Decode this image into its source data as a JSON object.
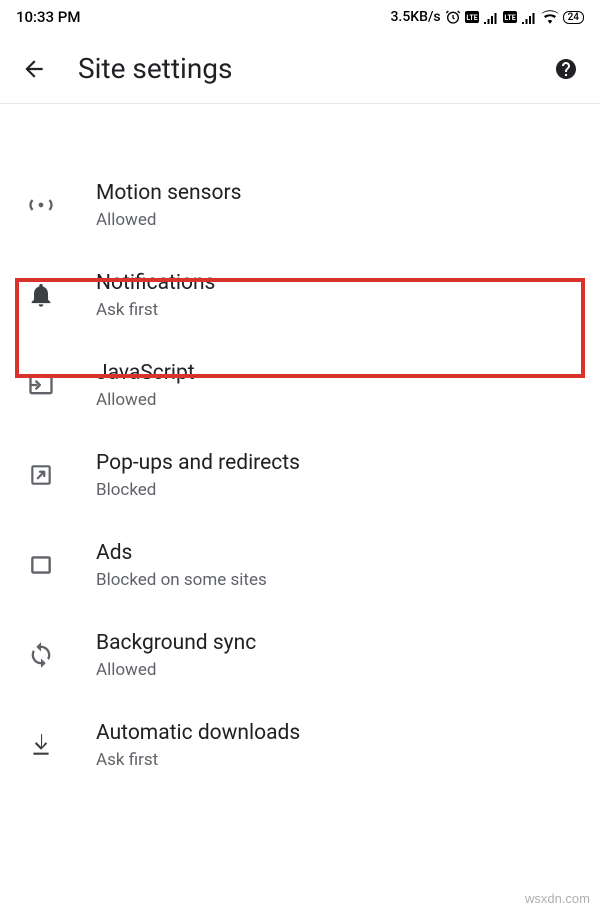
{
  "status_bar": {
    "time": "10:33 PM",
    "data_rate": "3.5KB/s",
    "battery": "24"
  },
  "app_bar": {
    "title": "Site settings"
  },
  "partial_item": {
    "status_fragment": "Ask first"
  },
  "settings": [
    {
      "id": "motion-sensors",
      "title": "Motion sensors",
      "status": "Allowed"
    },
    {
      "id": "notifications",
      "title": "Notifications",
      "status": "Ask first"
    },
    {
      "id": "javascript",
      "title": "JavaScript",
      "status": "Allowed"
    },
    {
      "id": "popups",
      "title": "Pop-ups and redirects",
      "status": "Blocked"
    },
    {
      "id": "ads",
      "title": "Ads",
      "status": "Blocked on some sites"
    },
    {
      "id": "background-sync",
      "title": "Background sync",
      "status": "Allowed"
    },
    {
      "id": "automatic-downloads",
      "title": "Automatic downloads",
      "status": "Ask first"
    }
  ],
  "watermark": "wsxdn.com"
}
